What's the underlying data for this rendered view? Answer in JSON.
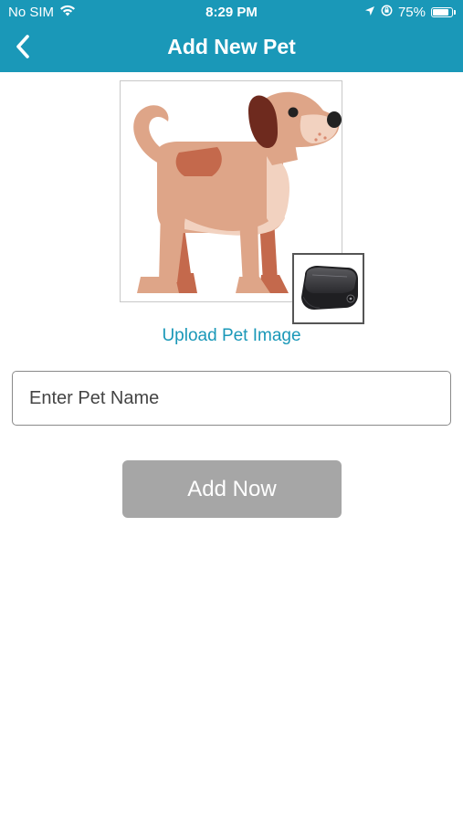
{
  "status_bar": {
    "carrier": "No SIM",
    "time": "8:29 PM",
    "battery_percent": "75%",
    "battery_level": 0.75,
    "icons": [
      "wifi-icon",
      "location-arrow-icon",
      "orientation-lock-icon",
      "battery-icon"
    ]
  },
  "nav": {
    "title": "Add New Pet",
    "back_icon": "chevron-left-icon"
  },
  "pet_image": {
    "illustration": "dog-illustration",
    "collar_thumbnail": "gps-collar-device-image",
    "upload_label": "Upload Pet Image"
  },
  "form": {
    "pet_name_value": "",
    "pet_name_placeholder": "Enter Pet Name",
    "submit_label": "Add Now"
  },
  "colors": {
    "header": "#1a98b8",
    "link": "#1a98b8",
    "button_disabled": "#a6a6a6",
    "dog_body": "#dea588",
    "dog_dark": "#c4694c",
    "dog_ear": "#6e2a1e"
  }
}
